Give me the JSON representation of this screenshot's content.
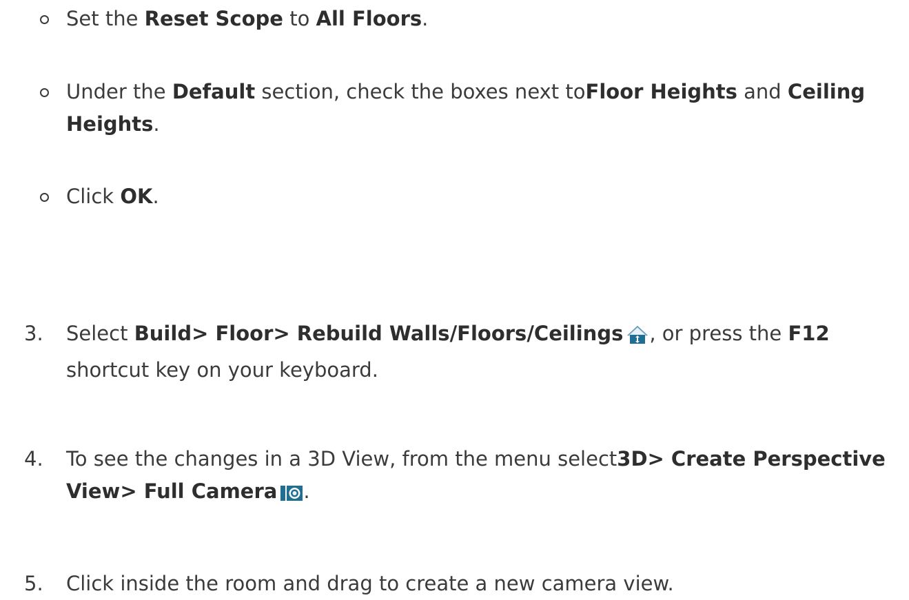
{
  "sub_steps": [
    {
      "parts": [
        {
          "t": "Set the ",
          "b": false
        },
        {
          "t": "Reset Scope",
          "b": true
        },
        {
          "t": " to ",
          "b": false
        },
        {
          "t": "All Floors",
          "b": true
        },
        {
          "t": ".",
          "b": false
        }
      ]
    },
    {
      "parts": [
        {
          "t": "Under the ",
          "b": false
        },
        {
          "t": "Default",
          "b": true
        },
        {
          "t": " section, check the boxes next to",
          "b": false
        },
        {
          "t": "Floor Heights",
          "b": true
        },
        {
          "t": " and ",
          "b": false
        },
        {
          "t": "Ceiling Heights",
          "b": true
        },
        {
          "t": ".",
          "b": false
        }
      ]
    },
    {
      "parts": [
        {
          "t": "Click ",
          "b": false
        },
        {
          "t": "OK",
          "b": true
        },
        {
          "t": ".",
          "b": false
        }
      ]
    }
  ],
  "steps": [
    {
      "number": "3.",
      "text_before_icon_plain": "Select ",
      "text_before_icon_bold": "Build> Floor> Rebuild Walls/Floors/Ceilings",
      "icon": "rebuild-walls-icon",
      "text_after_icon": ", or press the ",
      "key_bold": "F12",
      "text_end": " shortcut key on your keyboard."
    },
    {
      "number": "4.",
      "text_plain": "To see the changes in a 3D View, from the menu select",
      "menu_bold": "3D> Create Perspective View> Full Camera",
      "icon": "full-camera-icon",
      "text_end": "."
    },
    {
      "number": "5.",
      "text_plain": "Click inside the room and drag to create a new camera view."
    }
  ],
  "colors": {
    "text": "#3b3b3b",
    "icon_blue": "#1f6f94"
  }
}
